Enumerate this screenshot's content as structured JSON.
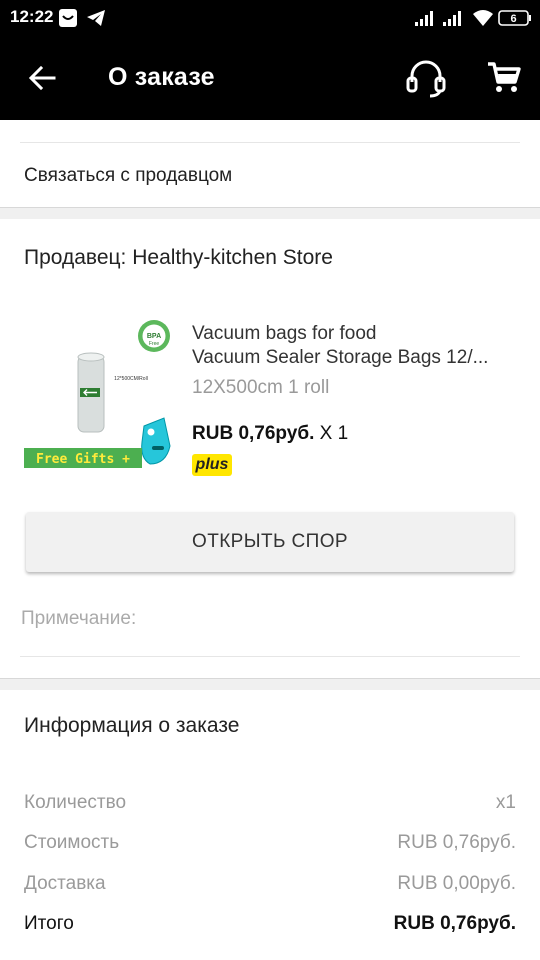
{
  "status_bar": {
    "time": "12:22",
    "battery_level": "6",
    "icons": [
      "smiley-notification-icon",
      "telegram-icon",
      "signal-icon",
      "signal-icon",
      "wifi-icon",
      "battery-icon"
    ]
  },
  "toolbar": {
    "back_icon": "arrow-left-icon",
    "title": "О заказе",
    "support_icon": "headset-icon",
    "cart_icon": "shopping-cart-icon"
  },
  "contact": {
    "label": "Связаться с продавцом"
  },
  "seller": {
    "label": "Продавец: Healthy-kitchen Store"
  },
  "product": {
    "title_line1": "Vacuum bags for food",
    "title_line2": "Vacuum Sealer Storage Bags 12/...",
    "variant": "12X500cm 1 roll",
    "price": "RUB 0,76руб.",
    "quantity": "X 1",
    "badge": "plus",
    "image": {
      "bpa_badge": "BPA",
      "bpa_sub": "Free",
      "roll_label": "12*500CM/Roll",
      "banner": "Free Gifts +"
    }
  },
  "dispute_button": {
    "label": "ОТКРЫТЬ СПОР"
  },
  "note": {
    "label": "Примечание:"
  },
  "order_info": {
    "title": "Информация о заказе",
    "rows": [
      {
        "label": "Количество",
        "value": "x1"
      },
      {
        "label": "Стоимость",
        "value": "RUB 0,76руб."
      },
      {
        "label": "Доставка",
        "value": "RUB 0,00руб."
      },
      {
        "label": "Итого",
        "value": "RUB 0,76руб."
      }
    ]
  },
  "colors": {
    "toolbar_bg": "#000000",
    "badge_yellow": "#ffe600",
    "banner_green": "#4caf50",
    "section_gap": "#f0f0f0"
  }
}
